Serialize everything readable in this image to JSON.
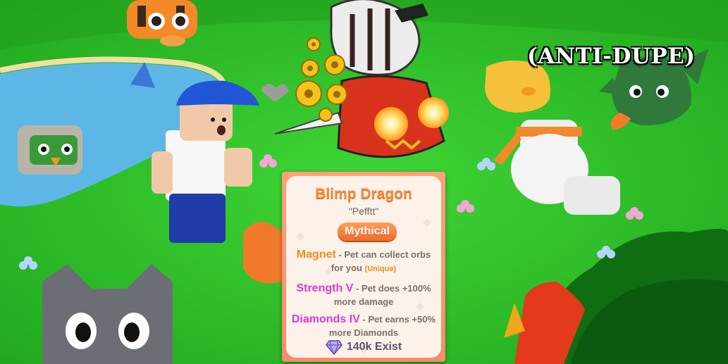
{
  "overlay": {
    "title": "(ANTI-DUPE)"
  },
  "pet_card": {
    "name": "Blimp Dragon",
    "sound": "\"Pefftt\"",
    "rarity": "Mythical",
    "enchants": [
      {
        "name": "Magnet",
        "description": "- Pet can collect orbs for you",
        "tag": "(Unique)",
        "color": "#f08a1c"
      },
      {
        "name": "Strength V",
        "description": "- Pet does +100% more damage",
        "tag": "",
        "color": "#d63ad8"
      },
      {
        "name": "Diamonds IV",
        "description": "- Pet earns +50% more Diamonds",
        "tag": "",
        "color": "#d63ad8"
      }
    ],
    "exist_count": "140k Exist"
  },
  "colors": {
    "grass": "#2fc92a",
    "water": "#5db7e6",
    "card_border": "#f88b6c",
    "name_orange": "#f08a3c",
    "rarity_orange": "#f36a2a"
  },
  "icons": [
    "diamond-icon",
    "gear-icon"
  ]
}
